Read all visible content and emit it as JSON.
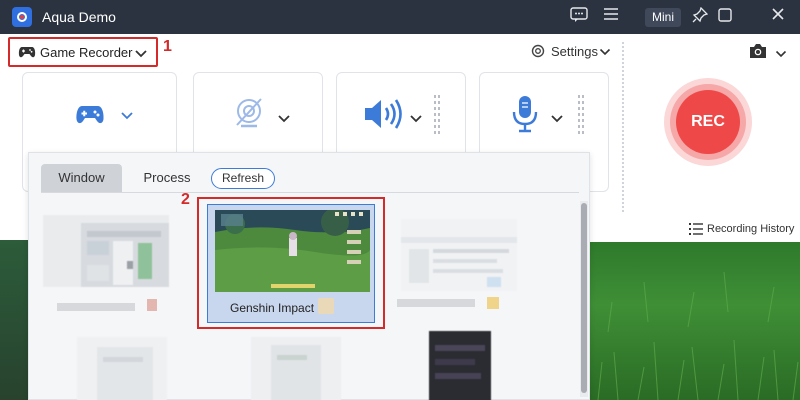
{
  "titlebar": {
    "app_title": "Aqua Demo",
    "mini_label": "Mini",
    "icons": [
      "chat-icon",
      "menu-icon",
      "pin-icon",
      "minimize-icon",
      "close-icon"
    ]
  },
  "toolbar": {
    "mode_label": "Game Recorder",
    "settings_label": "Settings"
  },
  "annotations": {
    "step1": "1",
    "step2": "2"
  },
  "sources": [
    {
      "name": "game-controller",
      "icon": "gamepad-icon"
    },
    {
      "name": "webcam",
      "icon": "webcam-off-icon"
    },
    {
      "name": "system-sound",
      "icon": "speaker-icon"
    },
    {
      "name": "microphone",
      "icon": "microphone-icon"
    }
  ],
  "rec": {
    "label": "REC"
  },
  "recording_history": {
    "label": "Recording History"
  },
  "popup": {
    "tabs": {
      "window": "Window",
      "process": "Process",
      "refresh": "Refresh"
    },
    "selected_window": {
      "label": "Genshin Impact"
    }
  },
  "colors": {
    "titlebar": "#2b3340",
    "accent": "#3d7bd9",
    "annotation": "#d42a2a",
    "rec": "#ef4848"
  }
}
